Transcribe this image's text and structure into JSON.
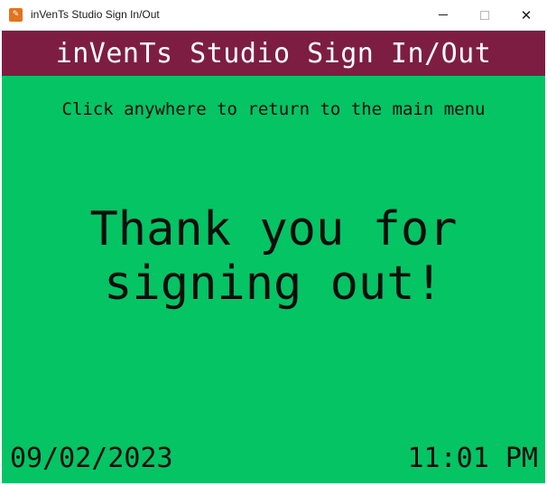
{
  "window": {
    "title": "inVenTs Studio Sign In/Out",
    "icon": "app-logo-icon",
    "controls": [
      "minimize-icon",
      "maximize-icon",
      "close-icon"
    ],
    "close_glyph": "✕"
  },
  "app": {
    "header_title": "inVenTs Studio Sign In/Out",
    "hint": "Click anywhere to return to the main menu",
    "message_line1": "Thank you for",
    "message_line2": "signing out!",
    "date": "09/02/2023",
    "time": "11:01 PM"
  },
  "colors": {
    "header_bg": "#7e1d42",
    "body_bg": "#04c464",
    "text": "#0d0d0d",
    "header_text": "#ffffff",
    "app_icon": "#e2731f"
  }
}
